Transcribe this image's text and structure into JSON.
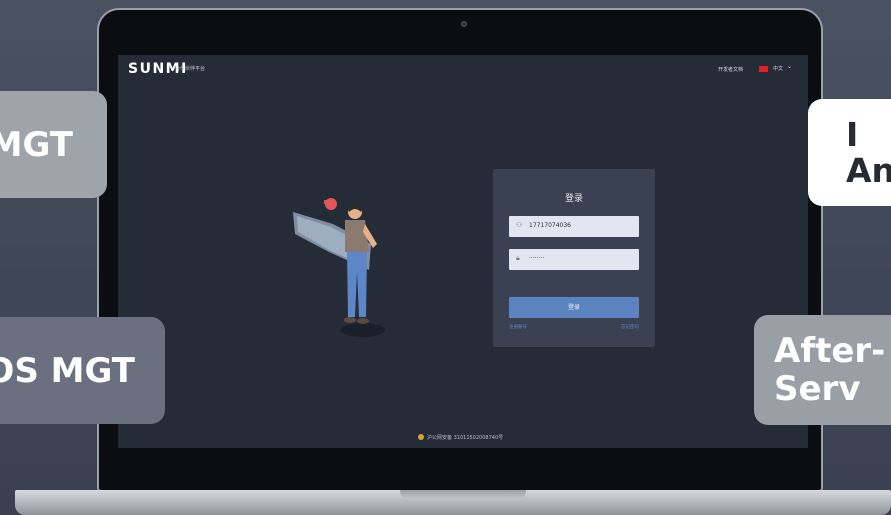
{
  "header": {
    "logo": "SUNMI",
    "logo_subtitle": "合作伙伴平台",
    "dev_docs": "开发者文档",
    "language": "中文"
  },
  "login": {
    "title": "登录",
    "phone_value": "17717074036",
    "password_value": "········",
    "submit_label": "登录",
    "link_left": "注册账号",
    "link_right": "忘记密码"
  },
  "footer": {
    "text": "沪公网安备 31011502008740号"
  },
  "overlays": {
    "top_left": "MGT",
    "bottom_left": "OS MGT",
    "top_right_line1": "I",
    "top_right_line2": "An",
    "bottom_right_line1": "After-",
    "bottom_right_line2": "Serv"
  },
  "icons": {
    "user": "user-icon",
    "lock": "lock-icon",
    "flag": "cn-flag-icon",
    "chevron": "chevron-down-icon"
  },
  "colors": {
    "screen_bg": "#252b37",
    "card_bg": "#3a4152",
    "accent": "#5a83c0"
  }
}
